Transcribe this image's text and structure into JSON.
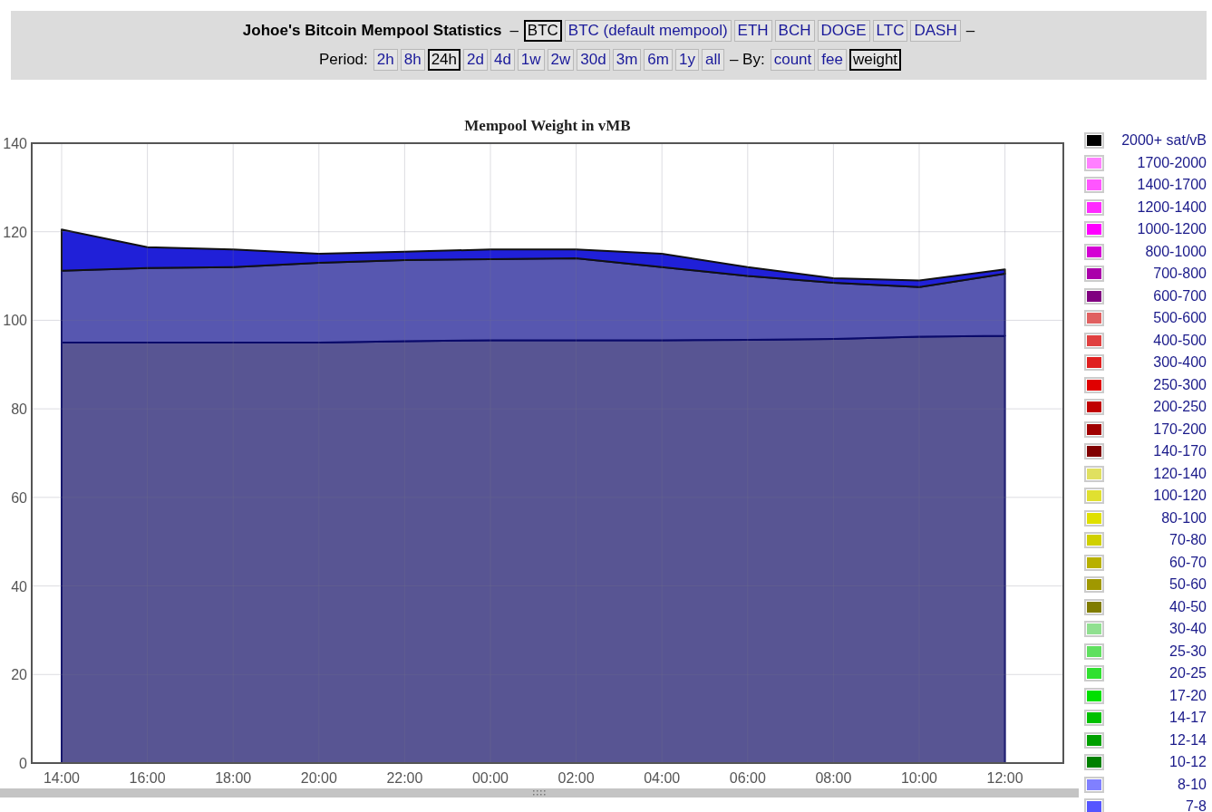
{
  "header": {
    "title": "Johoe's Bitcoin Mempool Statistics",
    "title_dash": "–",
    "coins": [
      {
        "label": "BTC",
        "selected": true
      },
      {
        "label": "BTC (default mempool)",
        "selected": false
      },
      {
        "label": "ETH",
        "selected": false
      },
      {
        "label": "BCH",
        "selected": false
      },
      {
        "label": "DOGE",
        "selected": false
      },
      {
        "label": "LTC",
        "selected": false
      },
      {
        "label": "DASH",
        "selected": false
      }
    ],
    "trailing_dash": "–",
    "period_label": "Period:",
    "periods": [
      {
        "label": "2h",
        "selected": false
      },
      {
        "label": "8h",
        "selected": false
      },
      {
        "label": "24h",
        "selected": true
      },
      {
        "label": "2d",
        "selected": false
      },
      {
        "label": "4d",
        "selected": false
      },
      {
        "label": "1w",
        "selected": false
      },
      {
        "label": "2w",
        "selected": false
      },
      {
        "label": "30d",
        "selected": false
      },
      {
        "label": "3m",
        "selected": false
      },
      {
        "label": "6m",
        "selected": false
      },
      {
        "label": "1y",
        "selected": false
      },
      {
        "label": "all",
        "selected": false
      }
    ],
    "by_label": "– By:",
    "by": [
      {
        "label": "count",
        "selected": false
      },
      {
        "label": "fee",
        "selected": false
      },
      {
        "label": "weight",
        "selected": true
      }
    ]
  },
  "chart": {
    "chart_data": {
      "type": "area",
      "title": "Mempool Weight in vMB",
      "stacked": true,
      "categories": [
        "14:00",
        "16:00",
        "18:00",
        "20:00",
        "22:00",
        "00:00",
        "02:00",
        "04:00",
        "06:00",
        "08:00",
        "10:00",
        "12:00"
      ],
      "series": [
        {
          "color": "#585593",
          "values": [
            95,
            95,
            95,
            95,
            95.3,
            95.5,
            95.5,
            95.5,
            95.6,
            95.8,
            96.3,
            96.5
          ]
        },
        {
          "color": "#5757b0",
          "values": [
            16.2,
            16.8,
            17,
            18,
            18.3,
            18.3,
            18.5,
            16.5,
            14.4,
            12.7,
            11.2,
            14
          ]
        },
        {
          "color": "#2020d8",
          "values": [
            9.3,
            4.7,
            4,
            2,
            1.9,
            2.2,
            2,
            3,
            2,
            1,
            1.5,
            1
          ]
        }
      ],
      "ylim": [
        0,
        140
      ],
      "grid": true,
      "yticks": [
        0,
        20,
        40,
        60,
        80,
        100,
        120,
        140
      ]
    }
  },
  "legend": [
    {
      "label": "2000+ sat/vB",
      "color": "#000000"
    },
    {
      "label": "1700-2000",
      "color": "#ff80ff"
    },
    {
      "label": "1400-1700",
      "color": "#ff55ff"
    },
    {
      "label": "1200-1400",
      "color": "#ff2bff"
    },
    {
      "label": "1000-1200",
      "color": "#ff00ff"
    },
    {
      "label": "800-1000",
      "color": "#d400d4"
    },
    {
      "label": "700-800",
      "color": "#aa00aa"
    },
    {
      "label": "600-700",
      "color": "#800080"
    },
    {
      "label": "500-600",
      "color": "#e06060"
    },
    {
      "label": "400-500",
      "color": "#e04040"
    },
    {
      "label": "300-400",
      "color": "#e02020"
    },
    {
      "label": "250-300",
      "color": "#e00000"
    },
    {
      "label": "200-250",
      "color": "#c00000"
    },
    {
      "label": "170-200",
      "color": "#a00000"
    },
    {
      "label": "140-170",
      "color": "#800000"
    },
    {
      "label": "120-140",
      "color": "#e0e060"
    },
    {
      "label": "100-120",
      "color": "#e0e030"
    },
    {
      "label": "80-100",
      "color": "#e0e000"
    },
    {
      "label": "70-80",
      "color": "#d0d000"
    },
    {
      "label": "60-70",
      "color": "#b8b000"
    },
    {
      "label": "50-60",
      "color": "#a09800"
    },
    {
      "label": "40-50",
      "color": "#807c00"
    },
    {
      "label": "30-40",
      "color": "#90e090"
    },
    {
      "label": "25-30",
      "color": "#60e060"
    },
    {
      "label": "20-25",
      "color": "#30e030"
    },
    {
      "label": "17-20",
      "color": "#00e000"
    },
    {
      "label": "14-17",
      "color": "#00c000"
    },
    {
      "label": "12-14",
      "color": "#00a000"
    },
    {
      "label": "10-12",
      "color": "#008000"
    },
    {
      "label": "8-10",
      "color": "#8080ff"
    },
    {
      "label": "7-8",
      "color": "#5555ff"
    }
  ]
}
